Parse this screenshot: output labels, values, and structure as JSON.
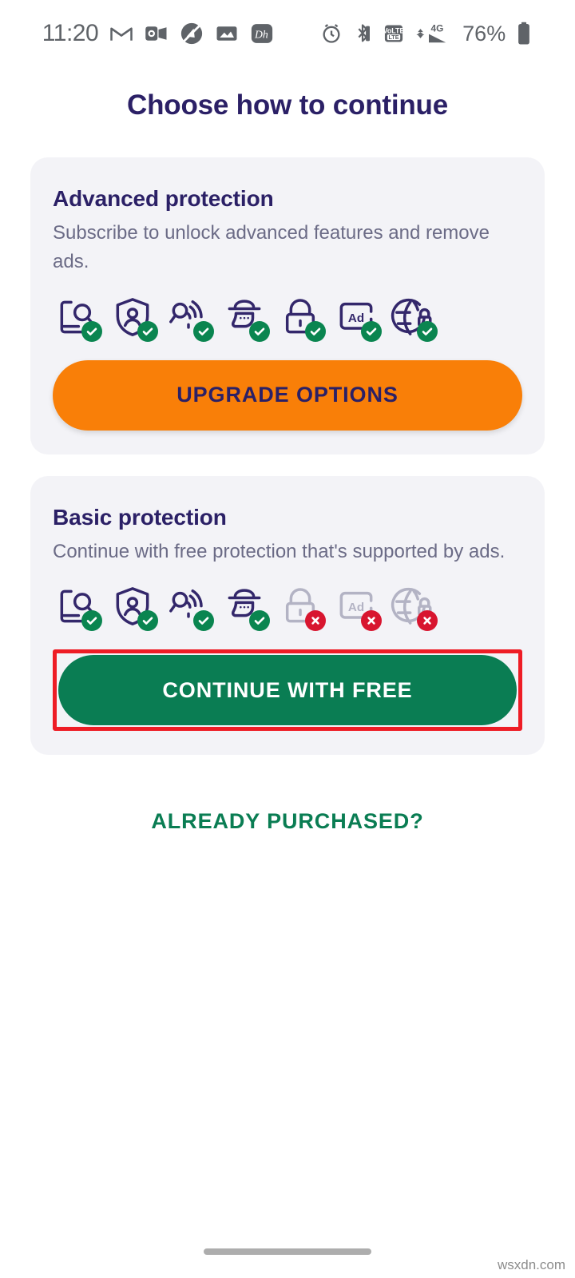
{
  "status_bar": {
    "time": "11:20",
    "battery_percent": "76%",
    "left_icons": [
      "gmail-icon",
      "outlook-icon",
      "no-sound-icon",
      "photos-icon",
      "disney-hotstar-icon"
    ],
    "right_icons": [
      "alarm-icon",
      "bluetooth-icon",
      "volte-icon",
      "signal-4g-icon",
      "battery-icon"
    ],
    "network": "4G",
    "volte_label": "VoLTE"
  },
  "page_title": "Choose how to continue",
  "cards": [
    {
      "title": "Advanced protection",
      "description": "Subscribe to unlock advanced features and remove ads.",
      "features": [
        {
          "icon": "device-scan-icon",
          "label": "Device scan",
          "enabled": true
        },
        {
          "icon": "shield-identity-icon",
          "label": "Identity protection",
          "enabled": true
        },
        {
          "icon": "wifi-scan-icon",
          "label": "Wi-Fi scan",
          "enabled": true
        },
        {
          "icon": "incognito-icon",
          "label": "Privacy",
          "enabled": true
        },
        {
          "icon": "lock-icon",
          "label": "App lock",
          "enabled": true
        },
        {
          "icon": "ad-block-icon",
          "label": "Ad free",
          "enabled": true
        },
        {
          "icon": "globe-lock-icon",
          "label": "Secure VPN",
          "enabled": true
        }
      ],
      "button": {
        "label": "UPGRADE OPTIONS",
        "style": "orange",
        "highlighted": false
      }
    },
    {
      "title": "Basic protection",
      "description": "Continue with free protection that's supported by ads.",
      "features": [
        {
          "icon": "device-scan-icon",
          "label": "Device scan",
          "enabled": true
        },
        {
          "icon": "shield-identity-icon",
          "label": "Identity protection",
          "enabled": true
        },
        {
          "icon": "wifi-scan-icon",
          "label": "Wi-Fi scan",
          "enabled": true
        },
        {
          "icon": "incognito-icon",
          "label": "Privacy",
          "enabled": true
        },
        {
          "icon": "lock-icon",
          "label": "App lock",
          "enabled": false
        },
        {
          "icon": "ad-block-icon",
          "label": "Ad free",
          "enabled": false
        },
        {
          "icon": "globe-lock-icon",
          "label": "Secure VPN",
          "enabled": false
        }
      ],
      "button": {
        "label": "CONTINUE WITH FREE",
        "style": "green",
        "highlighted": true
      }
    }
  ],
  "already_purchased": "ALREADY PURCHASED?",
  "watermark": "wsxdn.com",
  "colors": {
    "title_navy": "#2b2066",
    "card_bg": "#f3f3f7",
    "orange": "#f97f08",
    "green": "#0a7d53",
    "badge_green": "#0a8550",
    "badge_red": "#d8152f",
    "disabled_grey": "#b3b3c4",
    "highlight_red": "#ee1c25",
    "body_text": "#6b6b86"
  }
}
